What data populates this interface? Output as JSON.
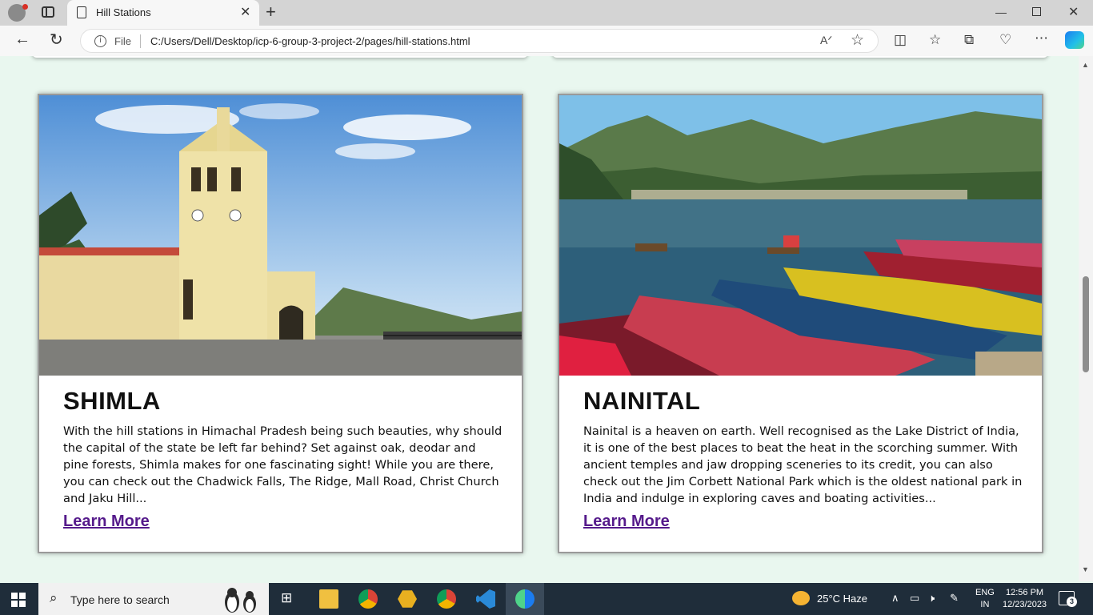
{
  "browser": {
    "tab_title": "Hill Stations",
    "address_prefix": "File",
    "url": "C:/Users/Dell/Desktop/icp-6-group-3-project-2/pages/hill-stations.html"
  },
  "cards": [
    {
      "title": "SHIMLA",
      "description": "With the hill stations in Himachal Pradesh being such beauties, why should the capital of the state be left far behind? Set against oak, deodar and pine forests, Shimla makes for one fascinating sight! While you are there, you can check out the Chadwick Falls, The Ridge, Mall Road, Christ Church and Jaku Hill...",
      "link": "Learn More"
    },
    {
      "title": "NAINITAL",
      "description": "Nainital is a heaven on earth. Well recognised as the Lake District of India, it is one of the best places to beat the heat in the scorching summer. With ancient temples and jaw dropping sceneries to its credit, you can also check out the Jim Corbett National Park which is the oldest national park in India and indulge in exploring caves and boating activities...",
      "link": "Learn More"
    }
  ],
  "taskbar": {
    "search_placeholder": "Type here to search",
    "weather": "25°C  Haze",
    "lang_top": "ENG",
    "lang_bottom": "IN",
    "time": "12:56 PM",
    "date": "12/23/2023",
    "notifications": "3"
  },
  "colors": {
    "page_background": "#e9f7ef",
    "link": "#551a8b",
    "taskbar": "#1f2d3a"
  }
}
